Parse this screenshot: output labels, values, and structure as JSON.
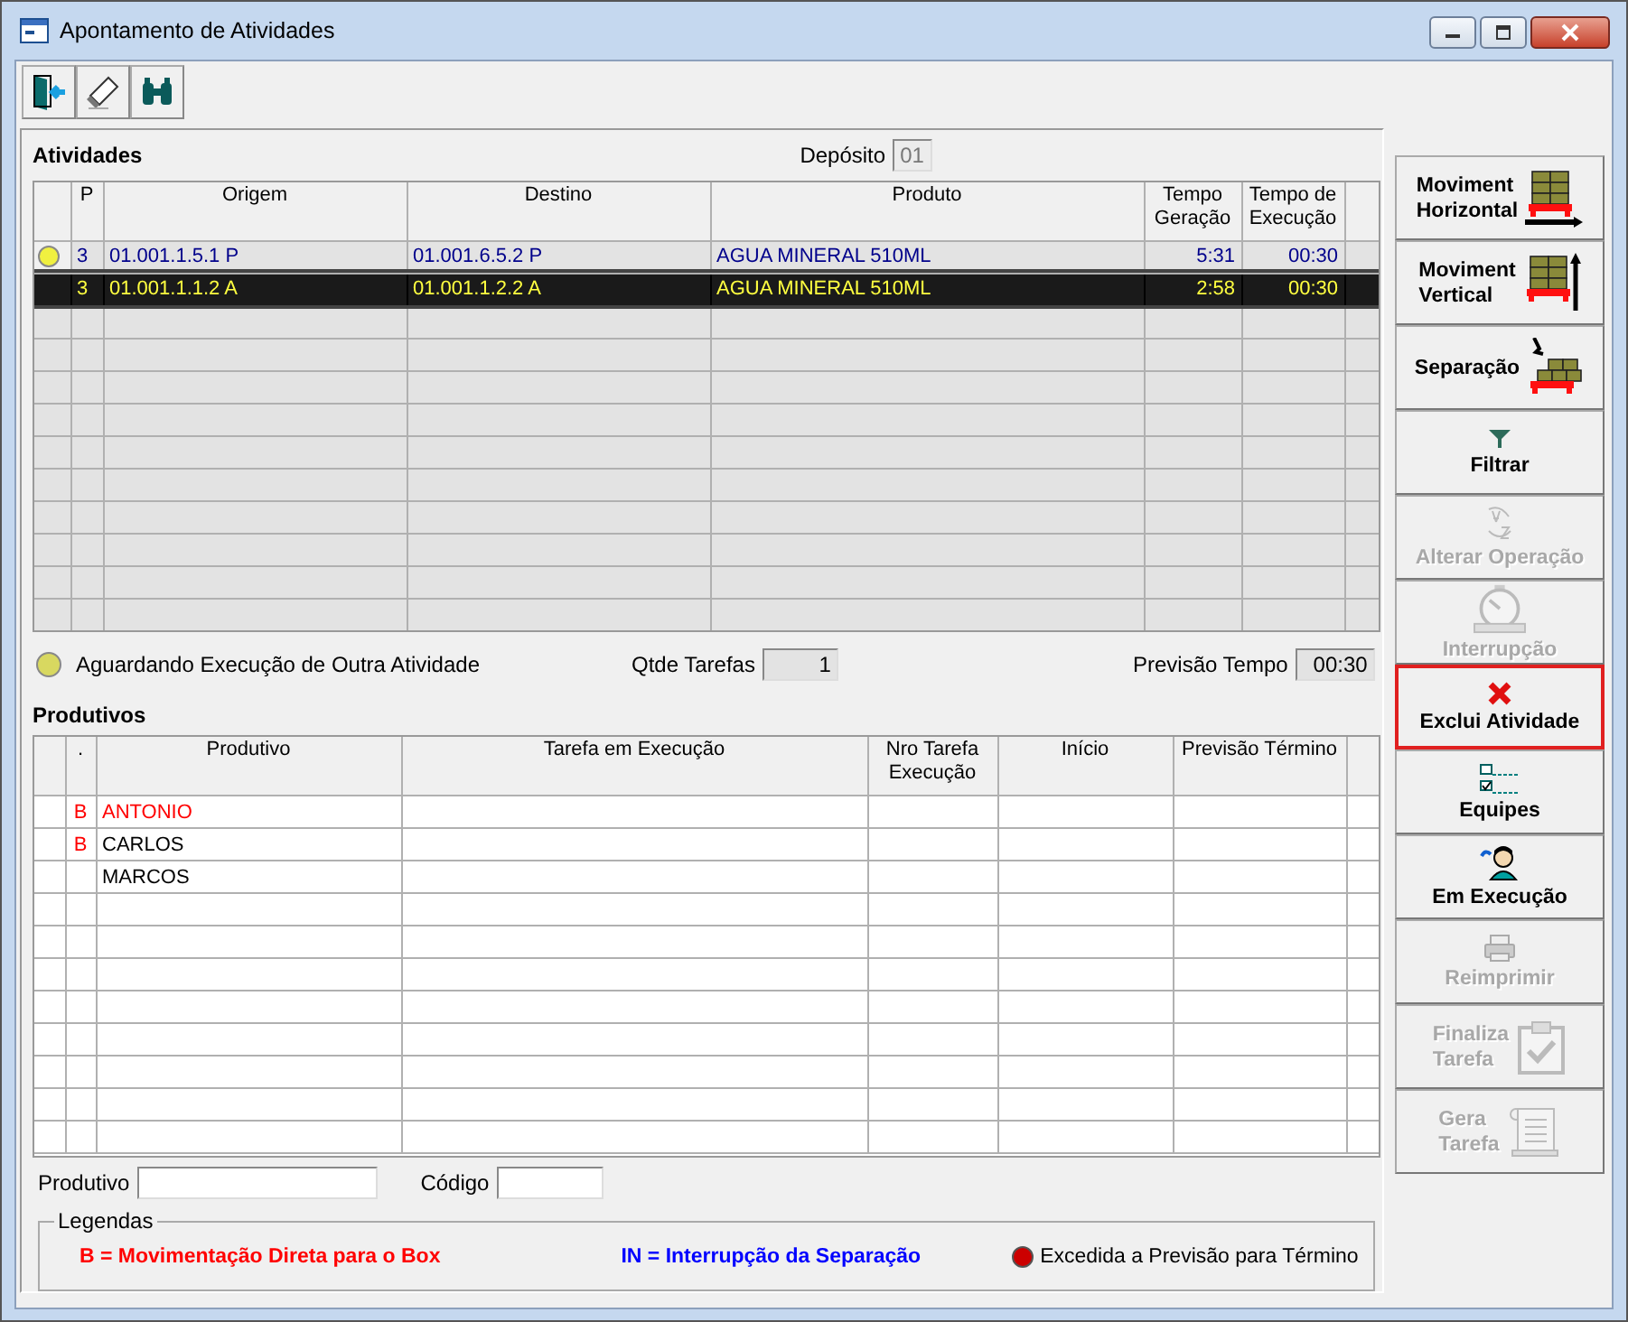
{
  "window": {
    "title": "Apontamento de Atividades"
  },
  "toolbar": [
    {
      "kind": "exit"
    },
    {
      "kind": "eraser"
    },
    {
      "kind": "binoculars"
    }
  ],
  "activities": {
    "title": "Atividades",
    "deposit_label": "Depósito",
    "deposit": "01",
    "columns": [
      "",
      "P",
      "Origem",
      "Destino",
      "Produto",
      "Tempo Geração",
      "Tempo de Execução"
    ],
    "rows": [
      {
        "waiting": true,
        "selected": false,
        "p": "3",
        "origem": "01.001.1.5.1 P",
        "destino": "01.001.6.5.2 P",
        "produto": "AGUA MINERAL 510ML",
        "tempo_geracao": "5:31",
        "tempo_execucao": "00:30"
      },
      {
        "waiting": false,
        "selected": true,
        "p": "3",
        "origem": "01.001.1.1.2 A",
        "destino": "01.001.1.2.2 A",
        "produto": "AGUA MINERAL 510ML",
        "tempo_geracao": "2:58",
        "tempo_execucao": "00:30"
      }
    ],
    "waiting_legend": "Aguardando Execução de Outra Atividade",
    "tasks_label": "Qtde Tarefas",
    "tasks": "1",
    "forecast_label": "Previsão Tempo",
    "forecast": "00:30"
  },
  "workers": {
    "title": "Produtivos",
    "columns": [
      ".",
      "Produtivo",
      "Tarefa em Execução",
      "Nro Tarefa Execução",
      "Início",
      "Previsão Término"
    ],
    "rows": [
      {
        "flag": "B",
        "name": "ANTONIO",
        "highlighted": true
      },
      {
        "flag": "B",
        "name": "CARLOS",
        "highlighted": false
      },
      {
        "name": "MARCOS",
        "highlighted": false
      }
    ],
    "filter_worker_label": "Produtivo",
    "filter_code_label": "Código"
  },
  "legend": {
    "title": "Legendas",
    "items": [
      {
        "kind": "key",
        "key": "B",
        "text": "= Movimentação Direta para o Box",
        "color": "#ff0000"
      },
      {
        "kind": "key",
        "key": "IN",
        "text": "= Interrupção da Separação",
        "color": "#0000ff"
      },
      {
        "kind": "dot",
        "text": "Excedida a Previsão para Término",
        "color": "#cc0000"
      }
    ]
  },
  "actions": [
    {
      "lines": [
        "Moviment",
        "Horizontal"
      ],
      "kind": "pallet-horizontal",
      "disabled": false,
      "focused": false
    },
    {
      "lines": [
        "Moviment",
        "Vertical"
      ],
      "kind": "pallet-vertical",
      "disabled": false,
      "focused": false
    },
    {
      "lines": [
        "Separação"
      ],
      "kind": "pallet-pick",
      "disabled": false,
      "focused": false
    },
    {
      "lines": [
        "Filtrar"
      ],
      "kind": "filter",
      "disabled": false,
      "focused": false
    },
    {
      "lines": [
        "Alterar Operação"
      ],
      "kind": "sort",
      "disabled": true,
      "focused": false
    },
    {
      "lines": [
        "Interrupção"
      ],
      "kind": "stopwatch",
      "disabled": true,
      "focused": false
    },
    {
      "lines": [
        "Exclui Atividade"
      ],
      "kind": "delete",
      "disabled": false,
      "focused": true
    },
    {
      "lines": [
        "Equipes"
      ],
      "kind": "checklist",
      "disabled": false,
      "focused": false
    },
    {
      "lines": [
        "Em Execução"
      ],
      "kind": "person",
      "disabled": false,
      "focused": false
    },
    {
      "lines": [
        "Reimprimir"
      ],
      "kind": "printer",
      "disabled": true,
      "focused": false
    },
    {
      "lines": [
        "Finaliza",
        "Tarefa"
      ],
      "kind": "clipboard",
      "disabled": true,
      "focused": false
    },
    {
      "lines": [
        "Gera",
        "Tarefa"
      ],
      "kind": "scroll",
      "disabled": true,
      "focused": false
    }
  ]
}
